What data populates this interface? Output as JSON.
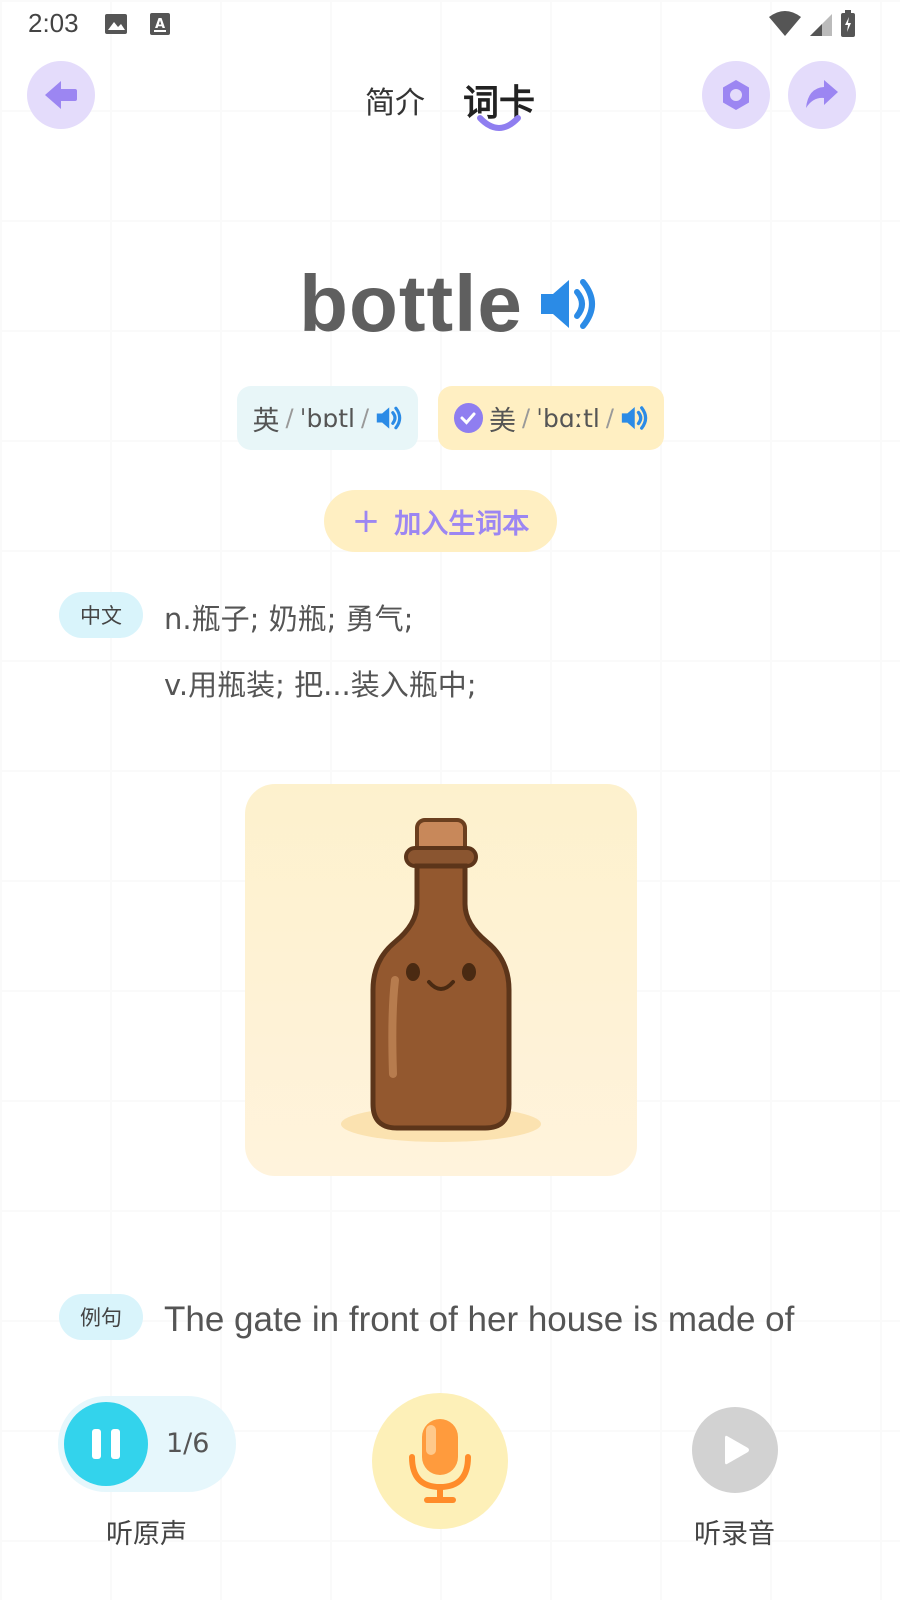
{
  "status_bar": {
    "time": "2:03",
    "icons": [
      "image-icon",
      "keyboard-a-icon",
      "wifi-icon",
      "signal-icon",
      "battery-icon"
    ]
  },
  "header": {
    "back_icon": "arrow-left-icon",
    "tabs": [
      {
        "label": "简介",
        "active": false
      },
      {
        "label": "词卡",
        "active": true
      }
    ],
    "settings_icon": "hexagon-settings-icon",
    "share_icon": "share-arrow-icon"
  },
  "word": {
    "text": "bottle",
    "speaker_icon": "speaker-icon"
  },
  "phonetics": [
    {
      "region": "英",
      "slash_open": "/",
      "ipa": "ˈbɒtl",
      "slash_close": "/",
      "selected": false
    },
    {
      "region": "美",
      "slash_open": "/",
      "ipa": "ˈbɑːtl",
      "slash_close": "/",
      "selected": true
    }
  ],
  "add_button": {
    "plus": "+",
    "label": "加入生词本"
  },
  "meaning": {
    "tag": "中文",
    "lines": [
      "n.瓶子; 奶瓶; 勇气;",
      "v.用瓶装; 把...装入瓶中;"
    ]
  },
  "illustration": {
    "subject": "bottle-illustration"
  },
  "example": {
    "tag": "例句",
    "sentence": "The gate in front of her house is made of"
  },
  "controls": {
    "play_state": "pause-icon",
    "counter": "1/6",
    "listen_original": "听原声",
    "mic_icon": "microphone-icon",
    "listen_recording": "听录音"
  },
  "colors": {
    "accent_purple": "#8f7ef0",
    "light_purple": "#e4dcfb",
    "cyan": "#33d3ec",
    "pale_yellow": "#ffefc2",
    "speaker_blue": "#2b8be6"
  }
}
